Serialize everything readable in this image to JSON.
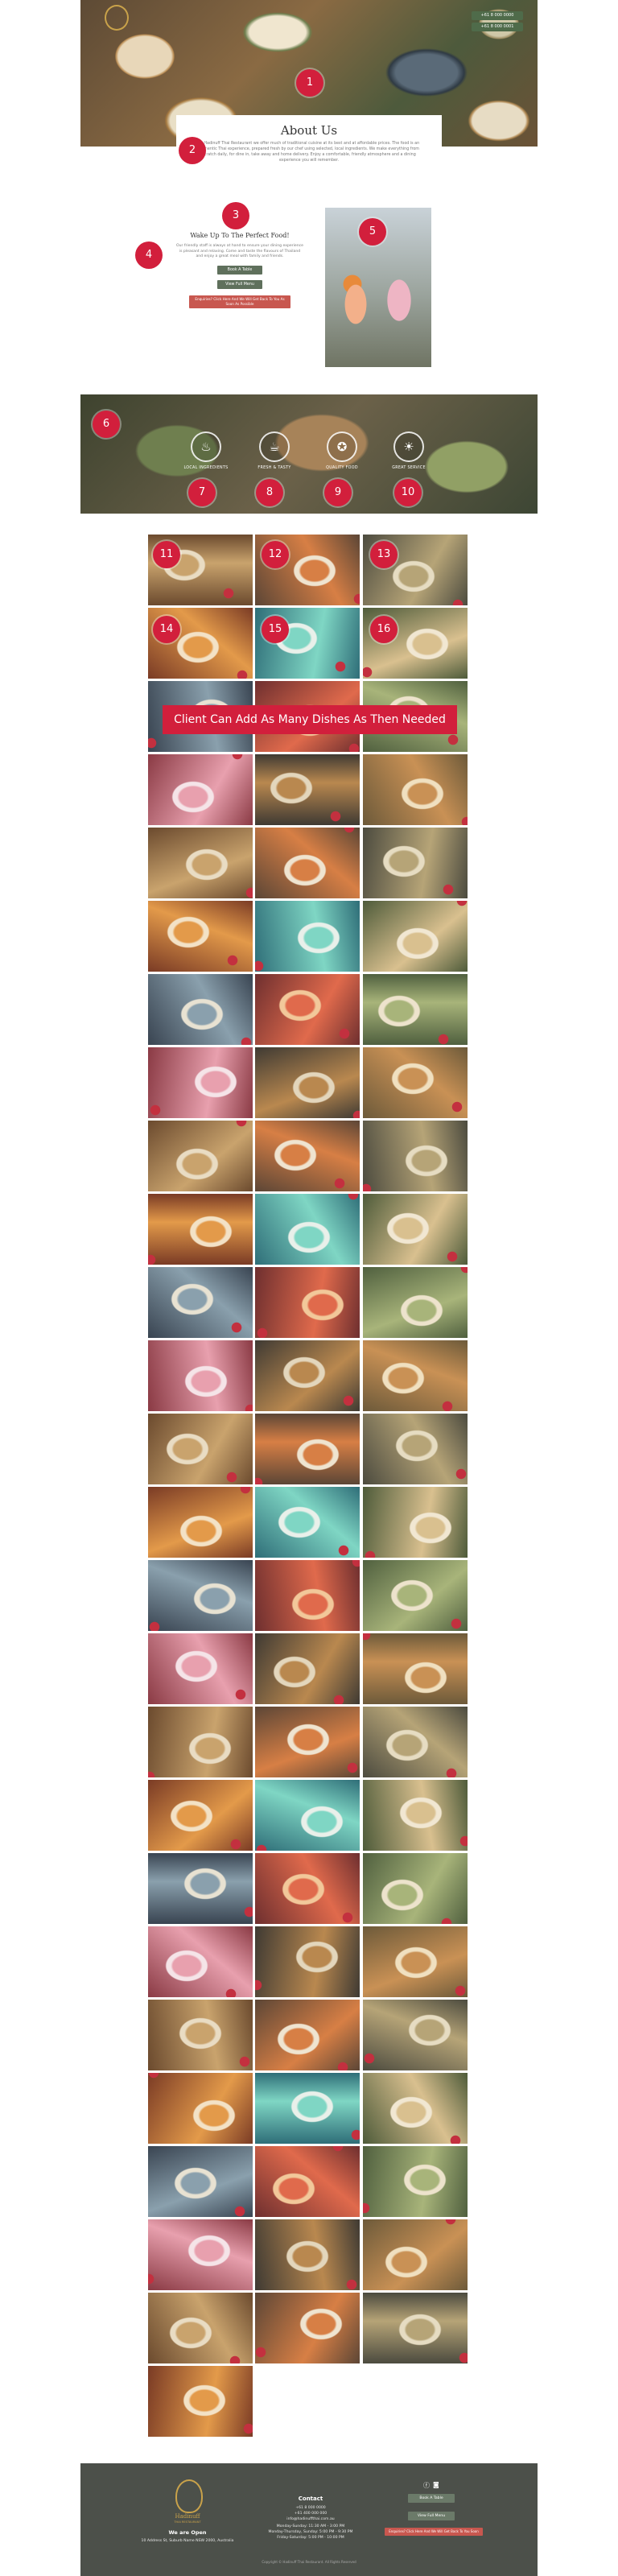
{
  "header": {
    "contact_buttons": [
      "+61 8 000 0000",
      "+61 8 000 0001"
    ]
  },
  "about": {
    "title": "About Us",
    "text": "At Hadinuff Thai Restaurant we offer much of traditional cuisine at its best and at affordable prices. The food is an authentic Thai experience, prepared fresh by our chef using selected, local ingredients. We make everything from scratch daily, for dine in, take away and home delivery. Enjoy a comfortable, friendly atmosphere and a dining experience you will remember."
  },
  "wake": {
    "title": "Wake Up To The Perfect Food!",
    "text": "Our friendly staff is always at hand to ensure your dining experience is pleasant and relaxing. Come and taste the flavours of Thailand and enjoy a great meal with family and friends.",
    "button1": "Book A Table",
    "button2": "View Full Menu",
    "red_button": "Enquiries? Click Here And We Will Get Back To You As Soon As Possible"
  },
  "features": [
    {
      "label": "LOCAL INGREDIENTS",
      "icon": "bowl-icon"
    },
    {
      "label": "FRESH & TASTY",
      "icon": "chef-icon"
    },
    {
      "label": "QUALITY FOOD",
      "icon": "ribbon-icon"
    },
    {
      "label": "GREAT SERVICE",
      "icon": "dish-icon"
    }
  ],
  "gallery": {
    "banner": "Client Can Add As Many Dishes As Then Needed",
    "rows": 26,
    "columns": 3,
    "tiles_in_last_row": 1
  },
  "markers": [
    "1",
    "2",
    "3",
    "4",
    "5",
    "6",
    "7",
    "8",
    "9",
    "10",
    "11",
    "12",
    "13",
    "14",
    "15",
    "16"
  ],
  "footer": {
    "brand": "Hadinuff",
    "brand_sub": "THAI RESTAURANT",
    "open_heading": "We are Open",
    "address": "10 Address St, Suburb Name NSW 2000, Australia",
    "contact_title": "Contact",
    "phone": "+61 8 000 0000",
    "mobile": "+61 400 000 000",
    "email": "info@hadinuffthai.com.au",
    "hours": [
      "Monday-Sunday: 11:30 AM - 3:00 PM",
      "Monday-Thursday, Sunday: 5:00 PM - 9:30 PM",
      "Friday-Saturday: 5:00 PM - 10:00 PM"
    ],
    "btn1": "Book A Table",
    "btn2": "View Full Menu",
    "red_button": "Enquiries? Click Here And We Will Get Back To You Soon",
    "copyright": "Copyright © Hadinuff Thai Restaurant. All Rights Reserved"
  },
  "colors": {
    "accent_red": "#d21f3c",
    "button_green": "#5f705c",
    "footer_bg": "#4c504a",
    "gold": "#c9a24a"
  }
}
